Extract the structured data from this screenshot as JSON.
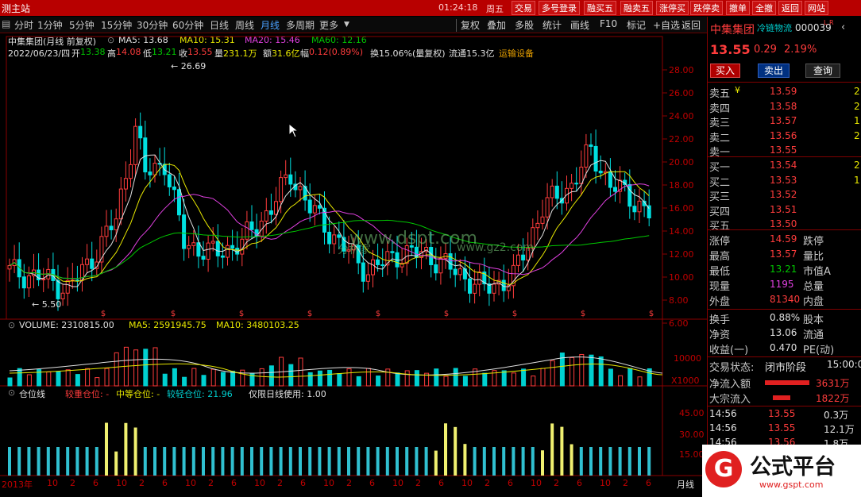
{
  "titlebar": {
    "app_name": "测主站",
    "time": "01:24:18",
    "weekday": "周五",
    "buttons": [
      "交易",
      "多号登录",
      "融买五",
      "融卖五",
      "涨停买",
      "跌停卖",
      "撤单",
      "全撤",
      "返回",
      "网站"
    ]
  },
  "periods": [
    "分时",
    "1分钟",
    "5分钟",
    "15分钟",
    "30分钟",
    "60分钟",
    "日线",
    "周线",
    "月线",
    "多周期",
    "更多"
  ],
  "active_period": "月线",
  "toolbar": [
    "复权",
    "叠加",
    "多股",
    "统计",
    "画线",
    "F10",
    "标记",
    "+自选",
    "返回"
  ],
  "info": {
    "stock_title": "中集集团(月线 前复权)",
    "ma5": "MA5: 13.68",
    "ma10": "MA10: 15.31",
    "ma20": "MA20: 15.46",
    "ma60": "MA60: 12.16",
    "date": "2022/06/23/四",
    "open_l": "开",
    "open": "13.38",
    "high_l": "高",
    "high": "14.08",
    "low_l": "低",
    "low": "13.21",
    "close_l": "收",
    "close": "13.55",
    "vol_l": "量",
    "vol": "231.1万",
    "amt_l": "额",
    "amt": "31.6亿",
    "chg_l": "幅",
    "chg": "0.12(0.89%)",
    "turn": "换15.06%(量复权)",
    "float": "流通15.3亿",
    "sector": "运输设备"
  },
  "main_axis": [
    "28.00",
    "26.00",
    "24.00",
    "22.00",
    "20.00",
    "18.00",
    "16.00",
    "14.00",
    "12.00",
    "10.00",
    "8.00",
    "6.00"
  ],
  "annotations": {
    "max": "26.69",
    "min": "5.50"
  },
  "volume": {
    "label": "VOLUME: 2310815.00",
    "ma5": "MA5: 2591945.75",
    "ma10": "MA10: 3480103.25",
    "axis": [
      "10000"
    ],
    "unit": "X1000"
  },
  "position": {
    "label": "仓位线",
    "heavy": "较重仓位: -",
    "medium": "中等仓位: -",
    "light": "较轻仓位: 21.96",
    "note": "仅限日线使用: 1.00",
    "axis": [
      "45.00",
      "30.00",
      "15.00"
    ]
  },
  "xaxis": {
    "labels": [
      "2013年",
      "10",
      "2",
      "6",
      "10",
      "2",
      "6",
      "10",
      "2",
      "6",
      "10",
      "2",
      "6",
      "10",
      "2",
      "6",
      "10",
      "2",
      "6",
      "10",
      "2",
      "6",
      "10",
      "2",
      "6",
      "10",
      "2",
      "6"
    ],
    "period_label": "月线"
  },
  "watermarks": {
    "w1": "www.dspt.com",
    "w2": "分析家",
    "w3": "www.gz2.com"
  },
  "right": {
    "name": "中集集团",
    "tag": "冷链物流",
    "code": "000039",
    "flags": "L R",
    "price": "13.55",
    "change": "0.29",
    "pct": "2.19%",
    "buy_btn": "买入",
    "sell_btn": "卖出",
    "query_btn": "查询",
    "asks": [
      {
        "label": "卖五",
        "sub": "¥",
        "price": "13.59",
        "vol": "2"
      },
      {
        "label": "卖四",
        "sub": "",
        "price": "13.58",
        "vol": "2"
      },
      {
        "label": "卖三",
        "sub": "",
        "price": "13.57",
        "vol": "1"
      },
      {
        "label": "卖二",
        "sub": "",
        "price": "13.56",
        "vol": "2"
      },
      {
        "label": "卖一",
        "sub": "",
        "price": "13.55",
        "vol": ""
      }
    ],
    "bids": [
      {
        "label": "买一",
        "price": "13.54",
        "vol": "2"
      },
      {
        "label": "买二",
        "price": "13.53",
        "vol": "1"
      },
      {
        "label": "买三",
        "price": "13.52",
        "vol": ""
      },
      {
        "label": "买四",
        "price": "13.51",
        "vol": ""
      },
      {
        "label": "买五",
        "price": "13.50",
        "vol": ""
      }
    ],
    "stats": [
      {
        "l1": "涨停",
        "v1": "14.59",
        "c1": "red",
        "l2": "跌停"
      },
      {
        "l1": "最高",
        "v1": "13.57",
        "c1": "red",
        "l2": "量比"
      },
      {
        "l1": "最低",
        "v1": "13.21",
        "c1": "green",
        "l2": "市值A"
      },
      {
        "l1": "现量",
        "v1": "1195",
        "c1": "magenta",
        "l2": "总量"
      },
      {
        "l1": "外盘",
        "v1": "81340",
        "c1": "red",
        "l2": "内盘"
      }
    ],
    "stats2": [
      {
        "l1": "换手",
        "v1": "0.88%",
        "l2": "股本"
      },
      {
        "l1": "净资",
        "v1": "13.06",
        "l2": "流通"
      },
      {
        "l1": "收益(一)",
        "v1": "0.470",
        "l2": "PE(动)"
      }
    ],
    "status_label": "交易状态:",
    "status": "闭市阶段",
    "status_time": "15:00:0",
    "flows": [
      {
        "label": "净流入额",
        "value": "3631万"
      },
      {
        "label": "大宗流入",
        "value": "1822万"
      }
    ],
    "ticks": [
      {
        "time": "14:56",
        "price": "13.55",
        "vol": "0.3万"
      },
      {
        "time": "14:56",
        "price": "13.55",
        "vol": "12.1万"
      },
      {
        "time": "14:56",
        "price": "13.56",
        "vol": "1.8万"
      },
      {
        "time": "14:56",
        "price": "",
        "vol": ""
      }
    ],
    "logo_text": "公式平台",
    "logo_url": "www.gspt.com",
    "logo_glyph": "G"
  }
}
